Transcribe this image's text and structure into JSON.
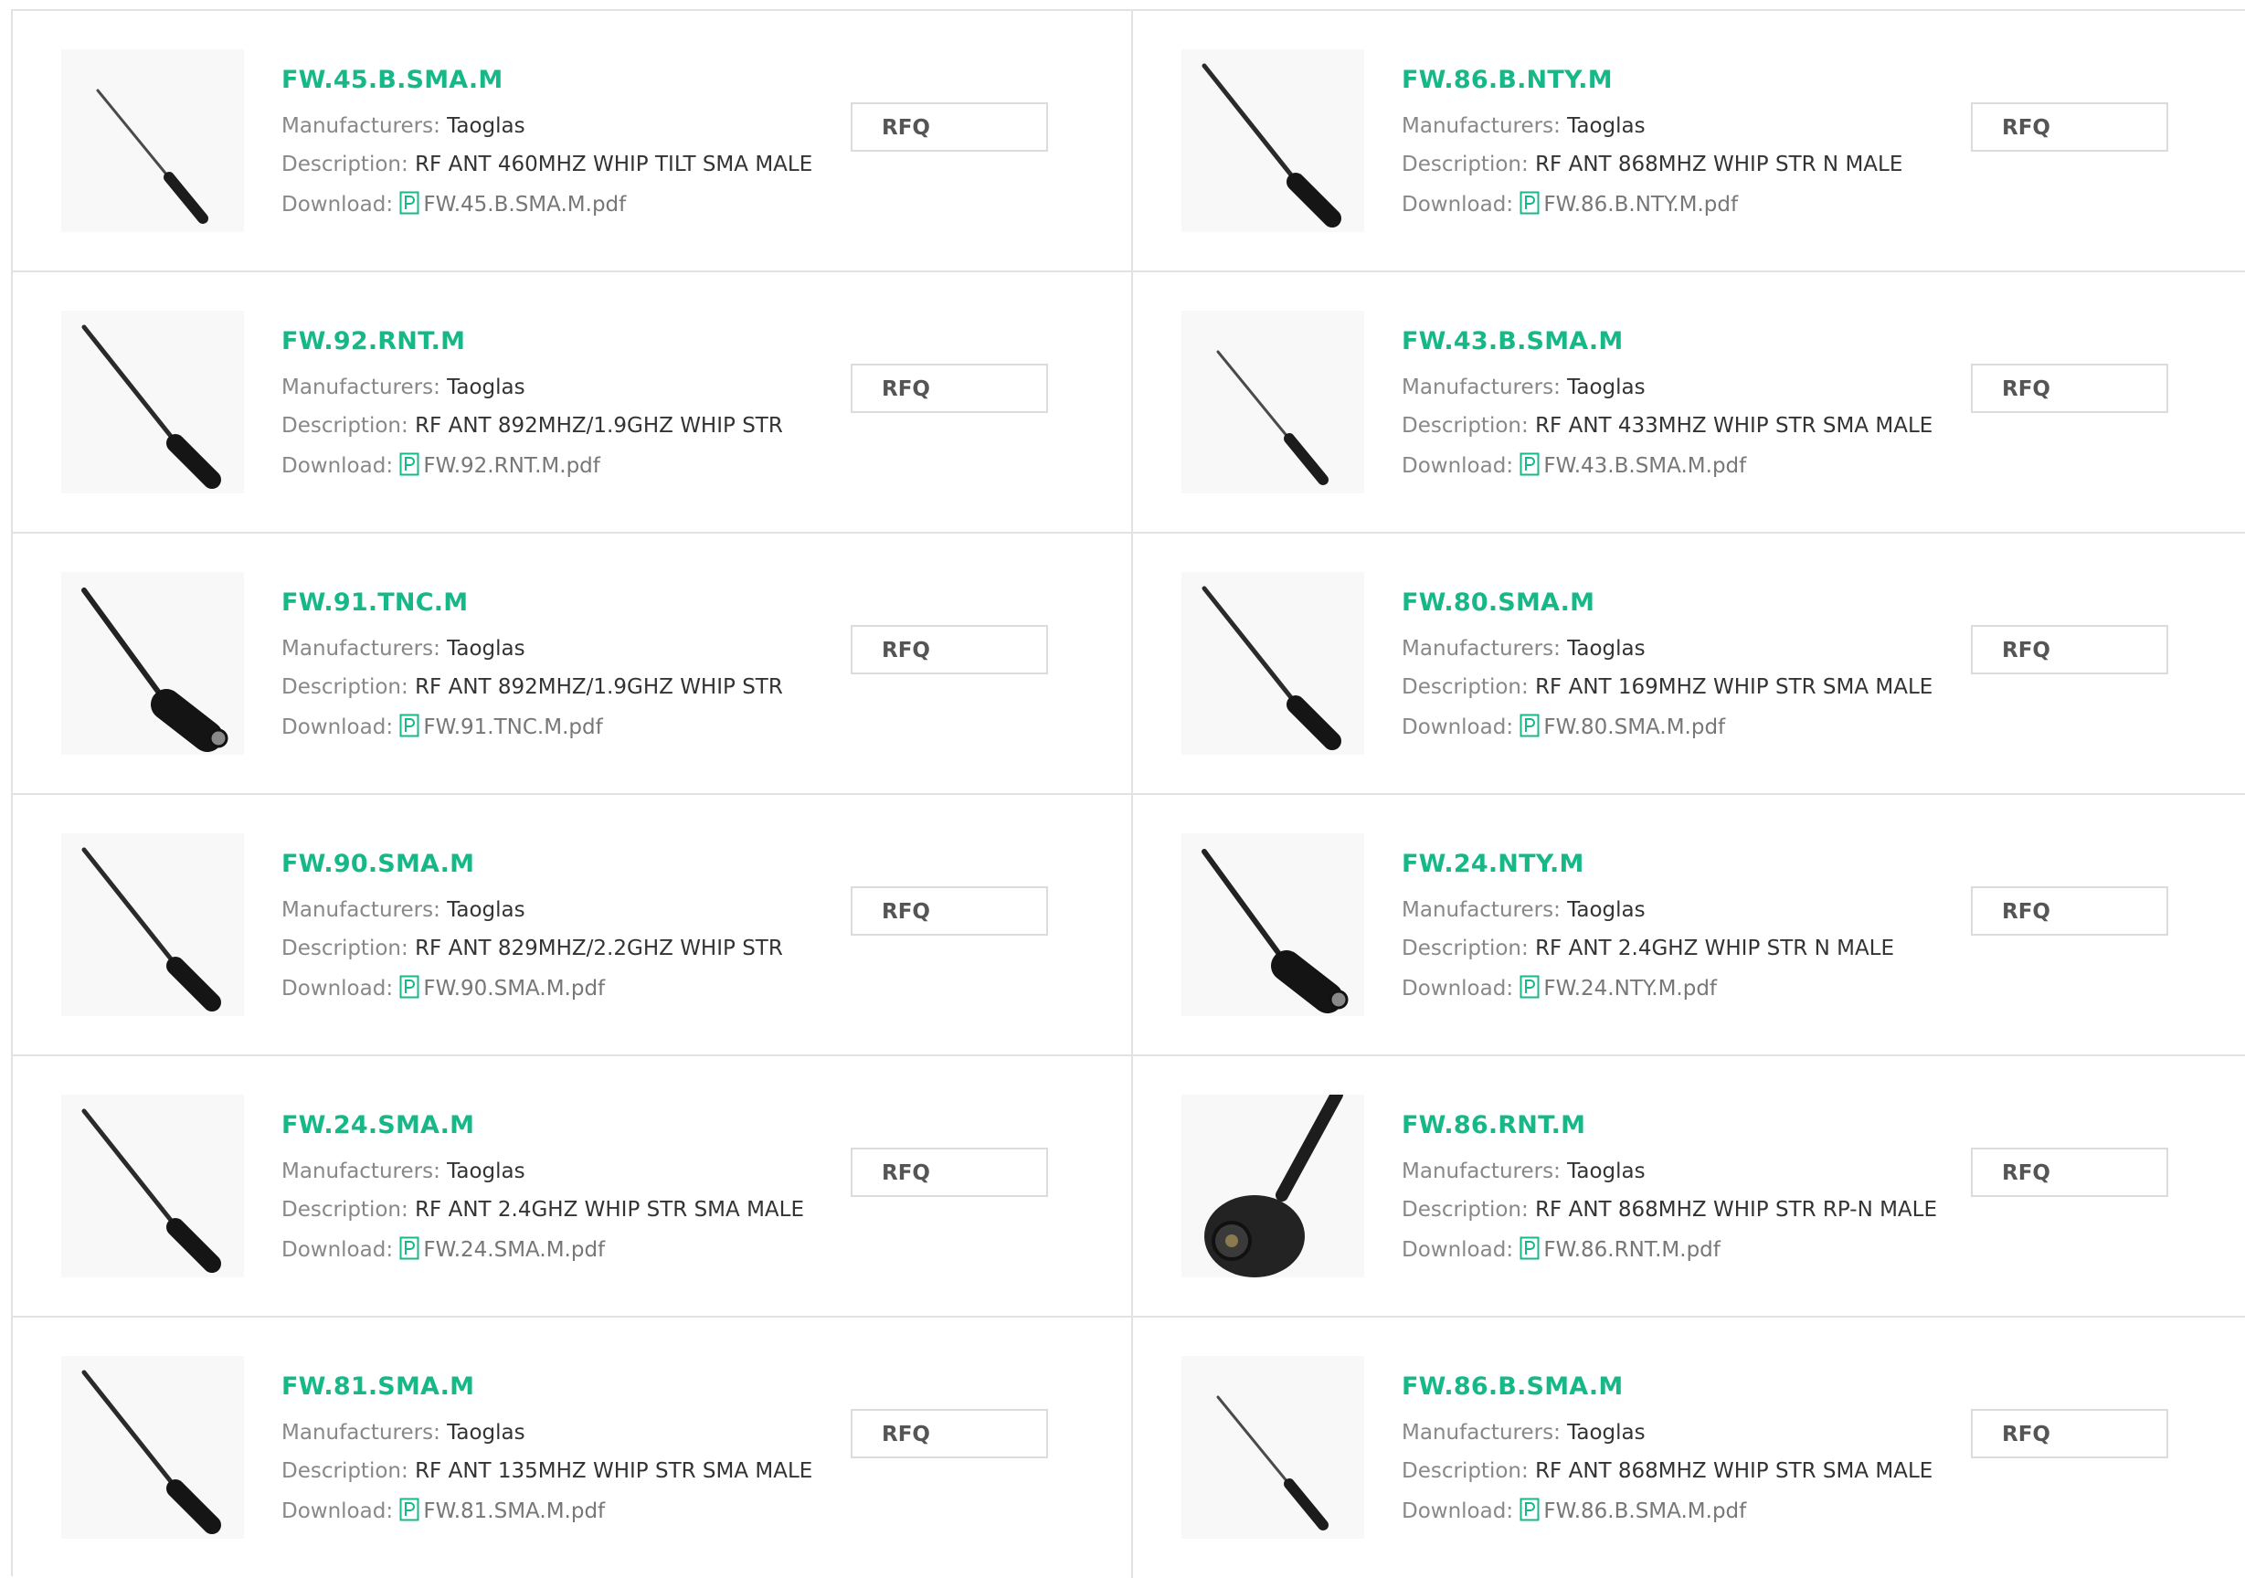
{
  "labels": {
    "manufacturer": "Manufacturers:",
    "description": "Description:",
    "download": "Download:",
    "rfq": "RFQ"
  },
  "accent_color": "#16b888",
  "products": [
    {
      "name": "FW.45.B.SMA.M",
      "manufacturer": "Taoglas",
      "description": "RF ANT 460MHZ WHIP TILT SMA MALE",
      "file": "FW.45.B.SMA.M.pdf",
      "image": "whip-antenna-thin"
    },
    {
      "name": "FW.86.B.NTY.M",
      "manufacturer": "Taoglas",
      "description": "RF ANT 868MHZ WHIP STR N MALE",
      "file": "FW.86.B.NTY.M.pdf",
      "image": "whip-antenna-long"
    },
    {
      "name": "FW.92.RNT.M",
      "manufacturer": "Taoglas",
      "description": "RF ANT 892MHZ/1.9GHZ WHIP STR",
      "file": "FW.92.RNT.M.pdf",
      "image": "whip-antenna-long"
    },
    {
      "name": "FW.43.B.SMA.M",
      "manufacturer": "Taoglas",
      "description": "RF ANT 433MHZ WHIP STR SMA MALE",
      "file": "FW.43.B.SMA.M.pdf",
      "image": "whip-antenna-thin"
    },
    {
      "name": "FW.91.TNC.M",
      "manufacturer": "Taoglas",
      "description": "RF ANT 892MHZ/1.9GHZ WHIP STR",
      "file": "FW.91.TNC.M.pdf",
      "image": "whip-antenna-thick"
    },
    {
      "name": "FW.80.SMA.M",
      "manufacturer": "Taoglas",
      "description": "RF ANT 169MHZ WHIP STR SMA MALE",
      "file": "FW.80.SMA.M.pdf",
      "image": "whip-antenna-long"
    },
    {
      "name": "FW.90.SMA.M",
      "manufacturer": "Taoglas",
      "description": "RF ANT 829MHZ/2.2GHZ WHIP STR",
      "file": "FW.90.SMA.M.pdf",
      "image": "whip-antenna-long"
    },
    {
      "name": "FW.24.NTY.M",
      "manufacturer": "Taoglas",
      "description": "RF ANT 2.4GHZ WHIP STR N MALE",
      "file": "FW.24.NTY.M.pdf",
      "image": "whip-antenna-thick"
    },
    {
      "name": "FW.24.SMA.M",
      "manufacturer": "Taoglas",
      "description": "RF ANT 2.4GHZ WHIP STR SMA MALE",
      "file": "FW.24.SMA.M.pdf",
      "image": "whip-antenna-long"
    },
    {
      "name": "FW.86.RNT.M",
      "manufacturer": "Taoglas",
      "description": "RF ANT 868MHZ WHIP STR RP-N MALE",
      "file": "FW.86.RNT.M.pdf",
      "image": "whip-antenna-closeup"
    },
    {
      "name": "FW.81.SMA.M",
      "manufacturer": "Taoglas",
      "description": "RF ANT 135MHZ WHIP STR SMA MALE",
      "file": "FW.81.SMA.M.pdf",
      "image": "whip-antenna-long"
    },
    {
      "name": "FW.86.B.SMA.M",
      "manufacturer": "Taoglas",
      "description": "RF ANT 868MHZ WHIP STR SMA MALE",
      "file": "FW.86.B.SMA.M.pdf",
      "image": "whip-antenna-thin"
    }
  ]
}
